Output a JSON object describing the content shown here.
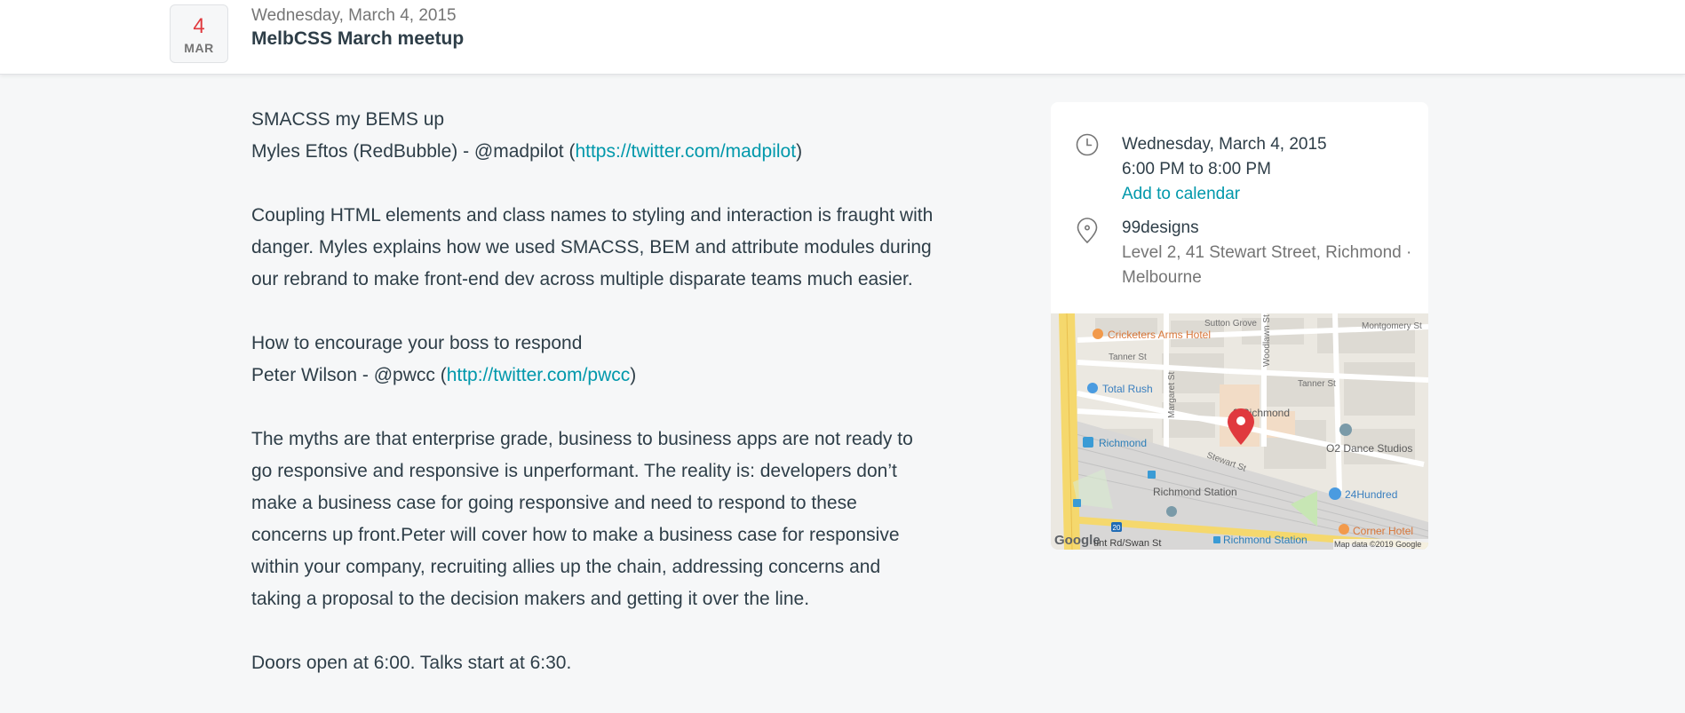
{
  "header": {
    "badge_day": "4",
    "badge_month": "MAR",
    "date": "Wednesday, March 4, 2015",
    "title": "MelbCSS March meetup"
  },
  "description": {
    "talk1_title": "SMACSS my BEMS up",
    "talk1_speaker_prefix": "Myles Eftos (RedBubble) - @madpilot (",
    "talk1_link": "https://twitter.com/madpilot",
    "talk1_speaker_suffix": ")",
    "talk1_body": "Coupling HTML elements and class names to styling and interaction is fraught with danger. Myles explains how we used SMACSS, BEM and attribute modules during our rebrand to make front-end dev across multiple disparate teams much easier.",
    "talk2_title": "How to encourage your boss to respond",
    "talk2_speaker_prefix": "Peter Wilson - @pwcc (",
    "talk2_link": "http://twitter.com/pwcc",
    "talk2_speaker_suffix": ")",
    "talk2_body": "The myths are that enterprise grade, business to business apps are not ready to go responsive and responsive is unperformant. The reality is: developers don’t make a business case for going responsive and need to respond to these concerns up front.Peter will cover how to make a business case for responsive within your company, recruiting allies up the chain, addressing concerns and taking a proposal to the decision makers and getting it over the line.",
    "closing": "Doors open at 6:00. Talks start at 6:30."
  },
  "sidebar": {
    "date": "Wednesday, March 4, 2015",
    "time": "6:00 PM to 8:00 PM",
    "add_to_calendar": "Add to calendar",
    "venue_name": "99designs",
    "venue_address": "Level 2, 41 Stewart Street, Richmond · Melbourne",
    "clock_icon": "clock-icon",
    "location_icon": "location-pin-icon"
  },
  "map": {
    "labels": {
      "sutton_grove": "Sutton Grove",
      "montgomery_st": "Montgomery St",
      "cricketers": "Cricketers Arms Hotel",
      "tanner_st_left": "Tanner St",
      "tanner_st_right": "Tanner St",
      "woodlawn_st": "Woodlawn St",
      "total_rush": "Total Rush",
      "margaret_st": "Margaret St",
      "richmond_place": "9 Richmond",
      "o2_dance": "O2 Dance Studios",
      "richmond": "Richmond",
      "stewart_st": "Stewart St",
      "richmond_station": "Richmond Station",
      "twenty_four_hundred": "24Hundred",
      "google": "Google",
      "punt_rd": "unt Rd/Swan St",
      "richmond_station_stop": "Richmond Station",
      "corner_hotel": "Corner Hotel",
      "map_data": "Map data ©2019 Google",
      "route_number": "20"
    },
    "colors": {
      "accent": "#0098ab",
      "marker": "#e0393e",
      "main_road": "#f5d86d"
    }
  }
}
